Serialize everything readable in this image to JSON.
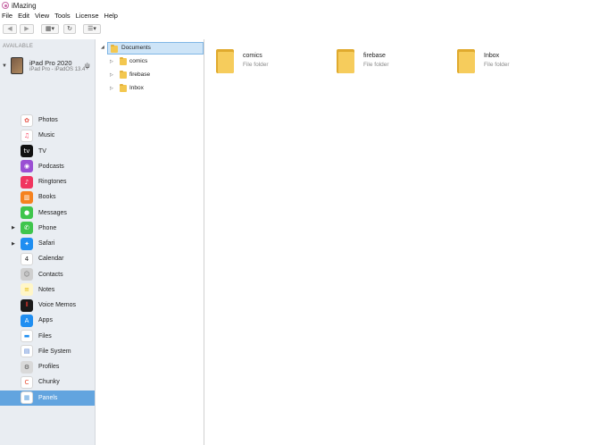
{
  "window": {
    "title": "iMazing"
  },
  "menu": [
    "File",
    "Edit",
    "View",
    "Tools",
    "License",
    "Help"
  ],
  "toolbar": {
    "back": "◀",
    "forward": "▶",
    "view_mode": "▦▾",
    "refresh": "↻",
    "sort": "☰▾"
  },
  "sidebar": {
    "section": "AVAILABLE",
    "device": {
      "name": "iPad Pro 2020",
      "subtitle": "iPad Pro - iPadOS 13.4"
    },
    "items": [
      {
        "label": "Photos",
        "icon": "photos-icon",
        "color": "#ffffff",
        "glyph": "✿",
        "glyph_color": "#e8564b",
        "arrow": ""
      },
      {
        "label": "Music",
        "icon": "music-icon",
        "color": "#ffffff",
        "glyph": "♫",
        "glyph_color": "#fa3c5a",
        "arrow": ""
      },
      {
        "label": "TV",
        "icon": "tv-icon",
        "color": "#111111",
        "glyph": "tv",
        "glyph_color": "#ffffff",
        "arrow": ""
      },
      {
        "label": "Podcasts",
        "icon": "podcasts-icon",
        "color": "#9a4fd3",
        "glyph": "◉",
        "glyph_color": "#ffffff",
        "arrow": ""
      },
      {
        "label": "Ringtones",
        "icon": "ringtones-icon",
        "color": "#f0355f",
        "glyph": "♪",
        "glyph_color": "#ffffff",
        "arrow": ""
      },
      {
        "label": "Books",
        "icon": "books-icon",
        "color": "#f5821f",
        "glyph": "▥",
        "glyph_color": "#ffffff",
        "arrow": ""
      },
      {
        "label": "Messages",
        "icon": "messages-icon",
        "color": "#3fc54c",
        "glyph": "●",
        "glyph_color": "#ffffff",
        "arrow": ""
      },
      {
        "label": "Phone",
        "icon": "phone-icon",
        "color": "#3fc54c",
        "glyph": "✆",
        "glyph_color": "#ffffff",
        "arrow": "▶"
      },
      {
        "label": "Safari",
        "icon": "safari-icon",
        "color": "#1f8ef1",
        "glyph": "✦",
        "glyph_color": "#ffffff",
        "arrow": "▶"
      },
      {
        "label": "Calendar",
        "icon": "calendar-icon",
        "color": "#ffffff",
        "glyph": "4",
        "glyph_color": "#222222",
        "arrow": ""
      },
      {
        "label": "Contacts",
        "icon": "contacts-icon",
        "color": "#cfcfcf",
        "glyph": "☺",
        "glyph_color": "#777777",
        "arrow": ""
      },
      {
        "label": "Notes",
        "icon": "notes-icon",
        "color": "#fff6c8",
        "glyph": "≡",
        "glyph_color": "#e6b800",
        "arrow": ""
      },
      {
        "label": "Voice Memos",
        "icon": "voice-memos-icon",
        "color": "#1a1a1a",
        "glyph": "⦀",
        "glyph_color": "#ff3b30",
        "arrow": ""
      },
      {
        "label": "Apps",
        "icon": "apps-icon",
        "color": "#1f8ef1",
        "glyph": "A",
        "glyph_color": "#ffffff",
        "arrow": ""
      },
      {
        "label": "Files",
        "icon": "files-icon",
        "color": "#ffffff",
        "glyph": "▬",
        "glyph_color": "#1f8ef1",
        "arrow": ""
      },
      {
        "label": "File System",
        "icon": "file-system-icon",
        "color": "#ffffff",
        "glyph": "▤",
        "glyph_color": "#4b7bd1",
        "arrow": ""
      },
      {
        "label": "Profiles",
        "icon": "profiles-icon",
        "color": "#d9d9d9",
        "glyph": "⚙",
        "glyph_color": "#555555",
        "arrow": ""
      },
      {
        "label": "Chunky",
        "icon": "chunky-icon",
        "color": "#ffffff",
        "glyph": "C",
        "glyph_color": "#e8482c",
        "arrow": ""
      },
      {
        "label": "Panels",
        "icon": "panels-icon",
        "color": "#ffffff",
        "glyph": "▦",
        "glyph_color": "#62a4df",
        "arrow": ""
      }
    ],
    "selected": "Panels"
  },
  "tree": {
    "root": "Documents",
    "children": [
      "comics",
      "firebase",
      "Inbox"
    ]
  },
  "files": [
    {
      "name": "comics",
      "type": "File folder"
    },
    {
      "name": "firebase",
      "type": "File folder"
    },
    {
      "name": "Inbox",
      "type": "File folder"
    }
  ]
}
